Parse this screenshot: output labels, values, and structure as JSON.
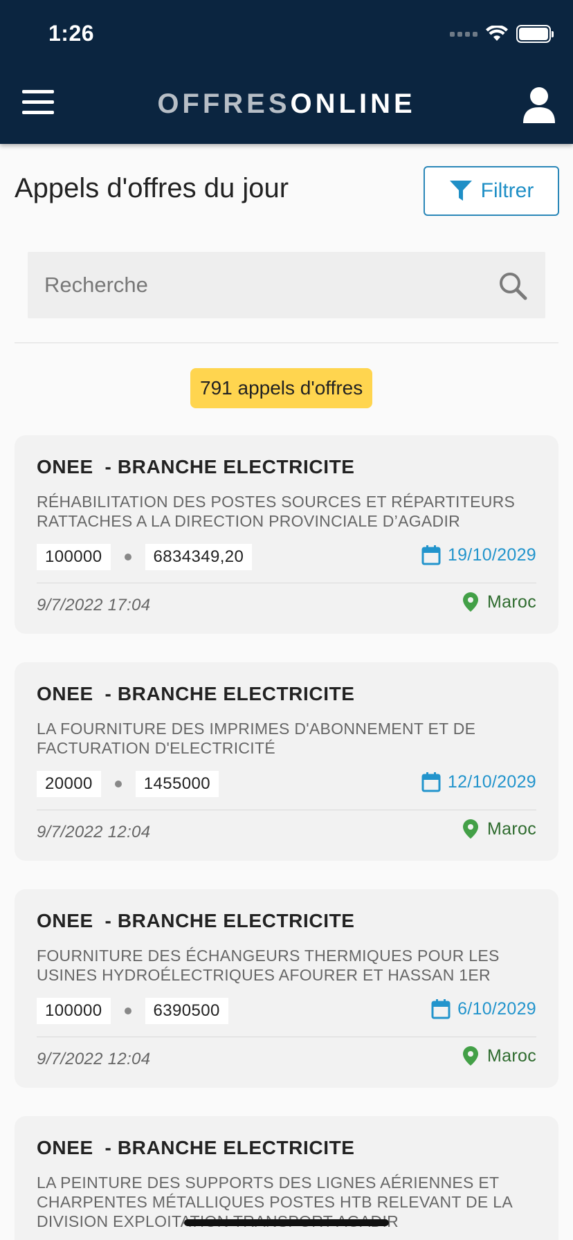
{
  "status_bar": {
    "time": "1:26"
  },
  "header": {
    "logo_part1": "OFFRES",
    "logo_part2": "ONLINE"
  },
  "page": {
    "title": "Appels d'offres du jour",
    "filter_label": "Filtrer"
  },
  "search": {
    "placeholder": "Recherche",
    "value": ""
  },
  "count_label": "791 appels d'offres",
  "colors": {
    "header": "#0b2540",
    "accent": "#1f8fc6",
    "badge": "#ffd54f",
    "location": "#43a047"
  },
  "cards": [
    {
      "org": "ONEE  - BRANCHE ELECTRICITE",
      "description": "RÉHABILITATION DES POSTES SOURCES ET RÉPARTITEURS RATTACHES A LA DIRECTION PROVINCIALE D’AGADIR",
      "amount1": "100000",
      "amount2": "6834349,20",
      "deadline": "19/10/2029",
      "published": "9/7/2022 17:04",
      "location": "Maroc"
    },
    {
      "org": "ONEE  - BRANCHE ELECTRICITE",
      "description": "LA FOURNITURE DES IMPRIMES D'ABONNEMENT ET DE FACTURATION D'ELECTRICITÉ",
      "amount1": "20000",
      "amount2": "1455000",
      "deadline": "12/10/2029",
      "published": "9/7/2022 12:04",
      "location": "Maroc"
    },
    {
      "org": "ONEE  - BRANCHE ELECTRICITE",
      "description": "FOURNITURE DES ÉCHANGEURS THERMIQUES POUR LES USINES HYDROÉLECTRIQUES AFOURER ET HASSAN 1ER",
      "amount1": "100000",
      "amount2": "6390500",
      "deadline": "6/10/2029",
      "published": "9/7/2022 12:04",
      "location": "Maroc"
    },
    {
      "org": "ONEE  - BRANCHE ELECTRICITE",
      "description": "LA PEINTURE DES SUPPORTS DES LIGNES AÉRIENNES ET CHARPENTES MÉTALLIQUES POSTES HTB RELEVANT DE LA DIVISION EXPLOITATION TRANSPORT AGADIR"
    }
  ]
}
